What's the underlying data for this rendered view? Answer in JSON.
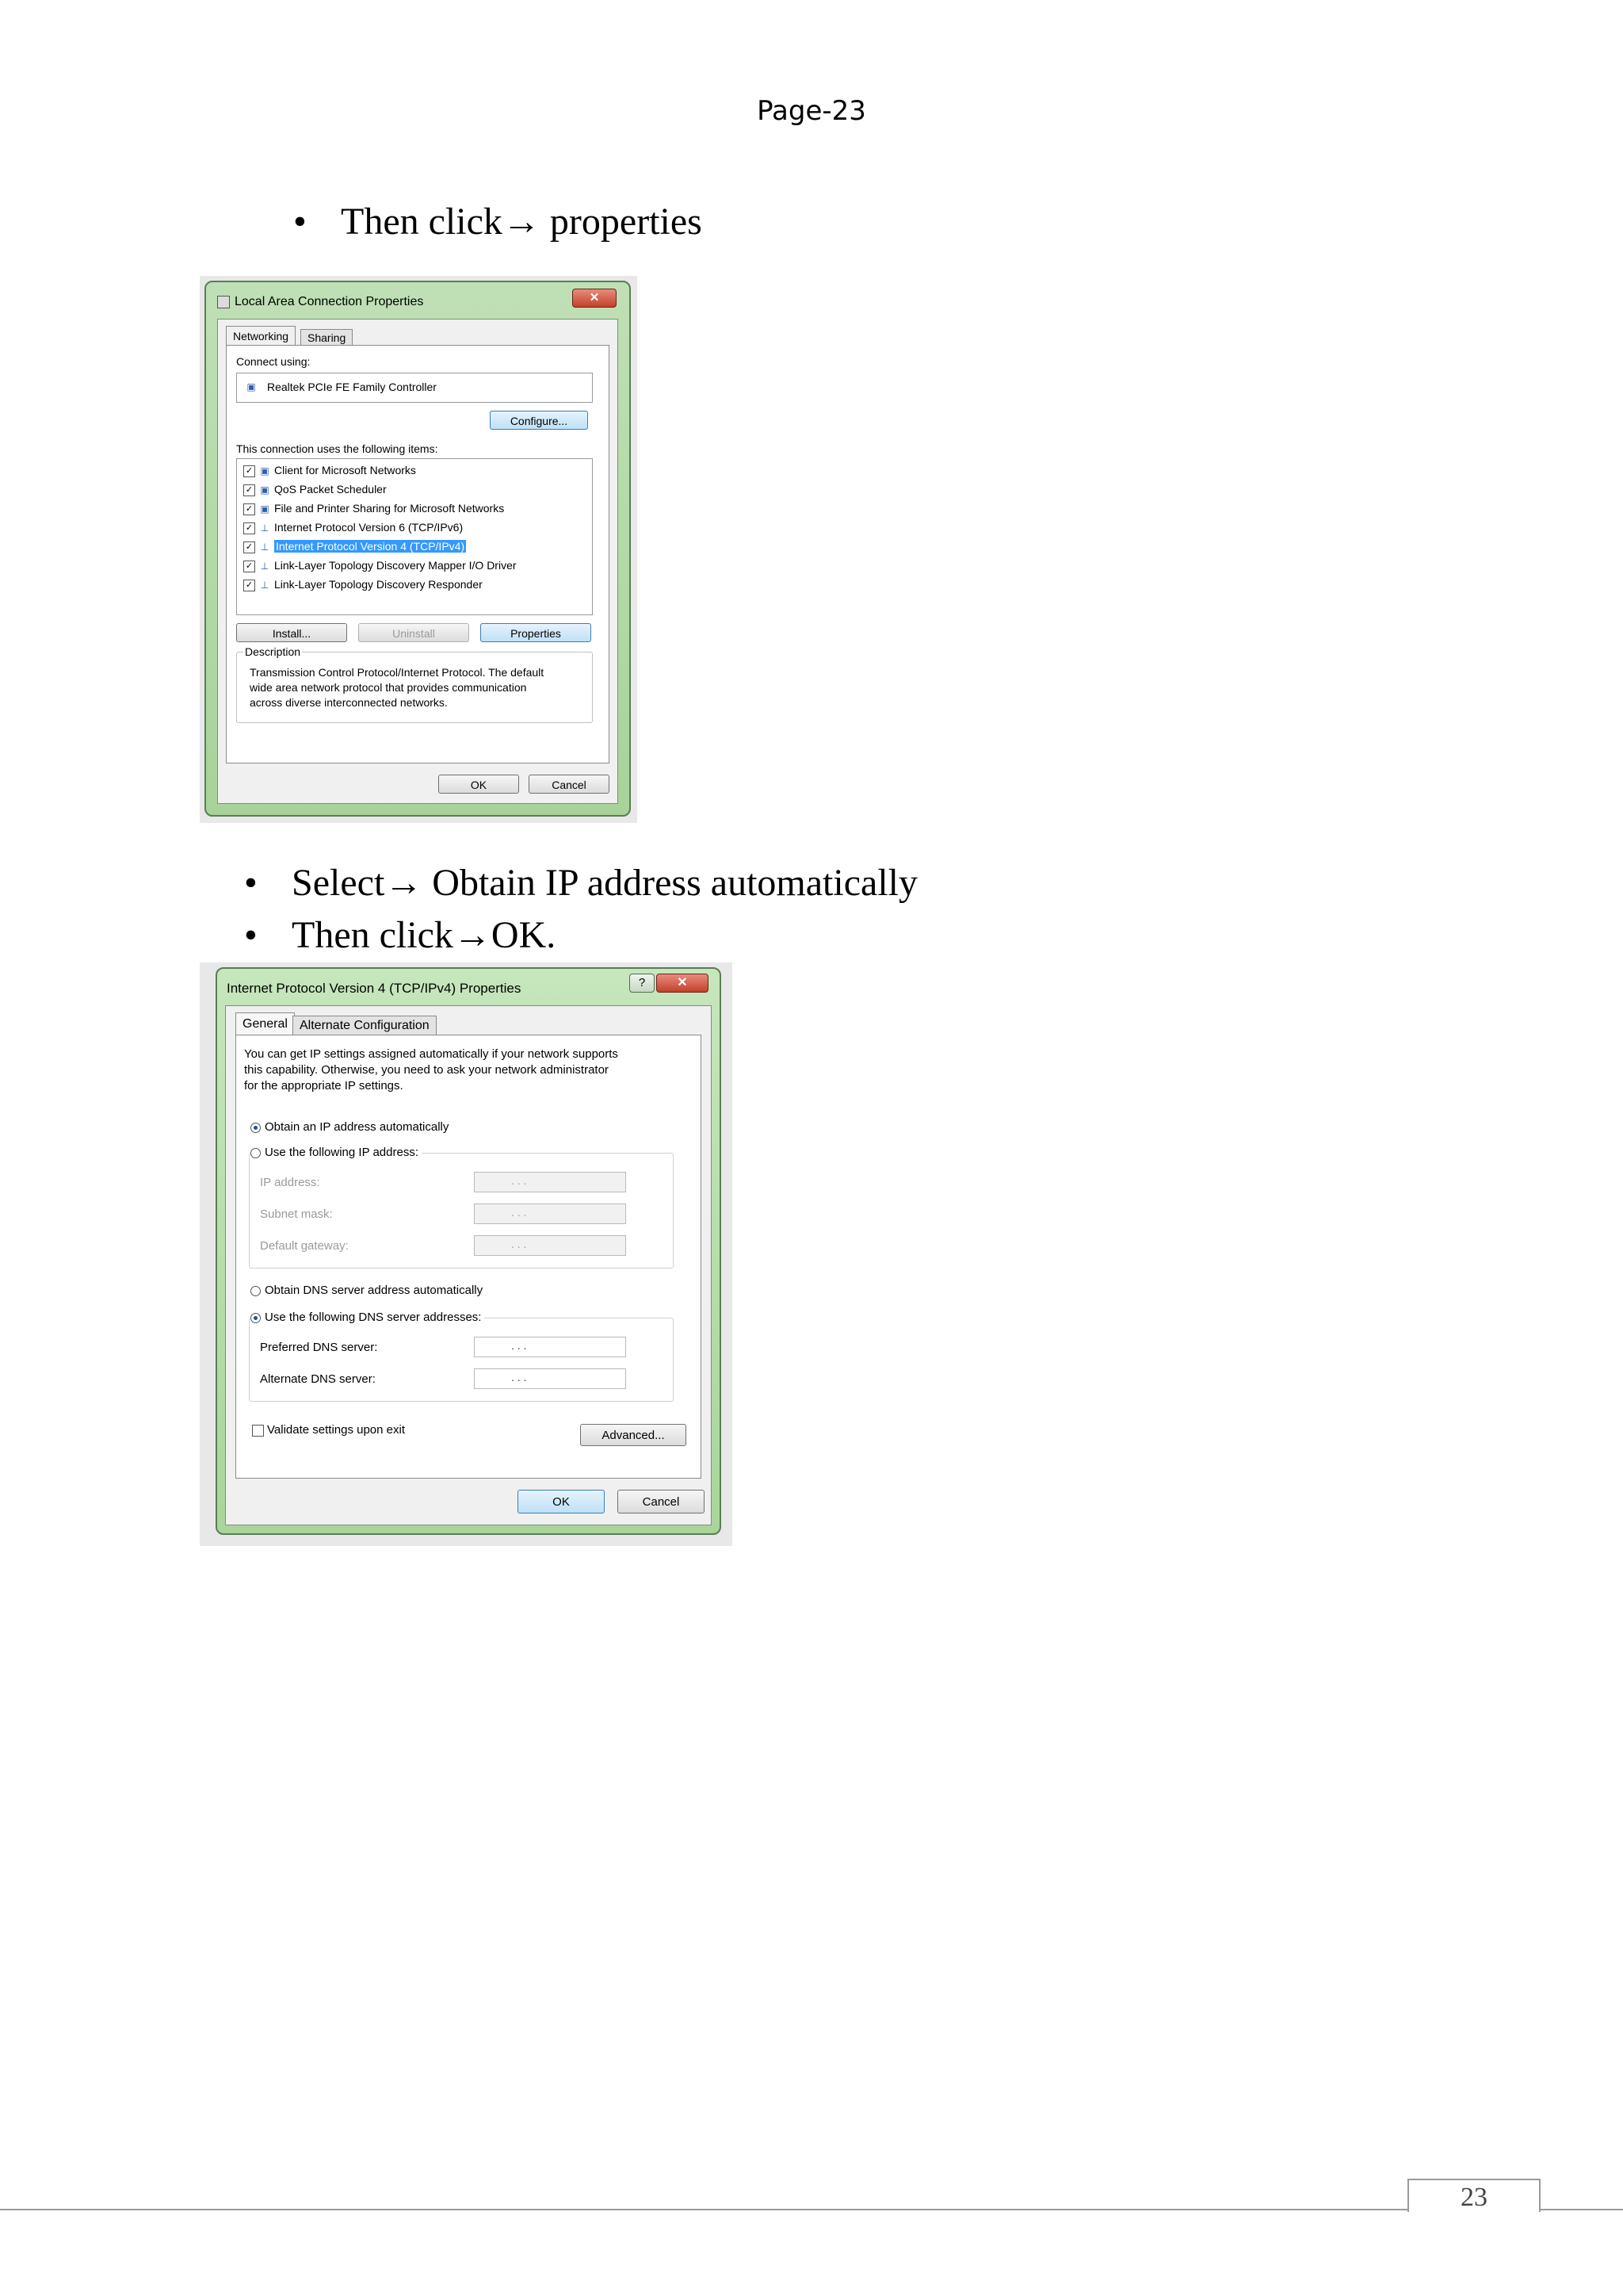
{
  "header": {
    "page_label": "Page-23"
  },
  "steps": {
    "step1": "Then click→ properties",
    "step2": "Select→ Obtain IP address automatically",
    "step3": "Then click→OK."
  },
  "lan_dialog": {
    "title": "Local Area Connection Properties",
    "close_glyph": "✕",
    "tabs": [
      "Networking",
      "Sharing"
    ],
    "connect_using_label": "Connect using:",
    "adapter_name": "Realtek PCIe FE Family Controller",
    "configure_button": "Configure...",
    "items_label": "This connection uses the following items:",
    "items": [
      "Client for Microsoft Networks",
      "QoS Packet Scheduler",
      "File and Printer Sharing for Microsoft Networks",
      "Internet Protocol Version 6 (TCP/IPv6)",
      "Internet Protocol Version 4 (TCP/IPv4)",
      "Link-Layer Topology Discovery Mapper I/O Driver",
      "Link-Layer Topology Discovery Responder"
    ],
    "selected_item_index": 4,
    "install_button": "Install...",
    "uninstall_button": "Uninstall",
    "properties_button": "Properties",
    "description_title": "Description",
    "description_lines": [
      "Transmission Control Protocol/Internet Protocol. The default",
      "wide area network protocol that provides communication",
      "across diverse interconnected networks."
    ],
    "ok_button": "OK",
    "cancel_button": "Cancel"
  },
  "ipv4_dialog": {
    "title": "Internet Protocol Version 4 (TCP/IPv4) Properties",
    "help_glyph": "?",
    "close_glyph": "✕",
    "tabs": [
      "General",
      "Alternate Configuration"
    ],
    "intro_lines": [
      "You can get IP settings assigned automatically if your network supports",
      "this capability. Otherwise, you need to ask your network administrator",
      "for the appropriate IP settings."
    ],
    "radio_obtain_ip": "Obtain an IP address automatically",
    "radio_use_ip": "Use the following IP address:",
    "ip_address_label": "IP address:",
    "subnet_mask_label": "Subnet mask:",
    "default_gateway_label": "Default gateway:",
    "radio_obtain_dns": "Obtain DNS server address automatically",
    "radio_use_dns": "Use the following DNS server addresses:",
    "preferred_dns_label": "Preferred DNS server:",
    "alternate_dns_label": "Alternate DNS server:",
    "ip_placeholder": ".   .   .",
    "validate_label": "Validate settings upon exit",
    "advanced_button": "Advanced...",
    "ok_button": "OK",
    "cancel_button": "Cancel"
  },
  "footer": {
    "page_number": "23"
  }
}
